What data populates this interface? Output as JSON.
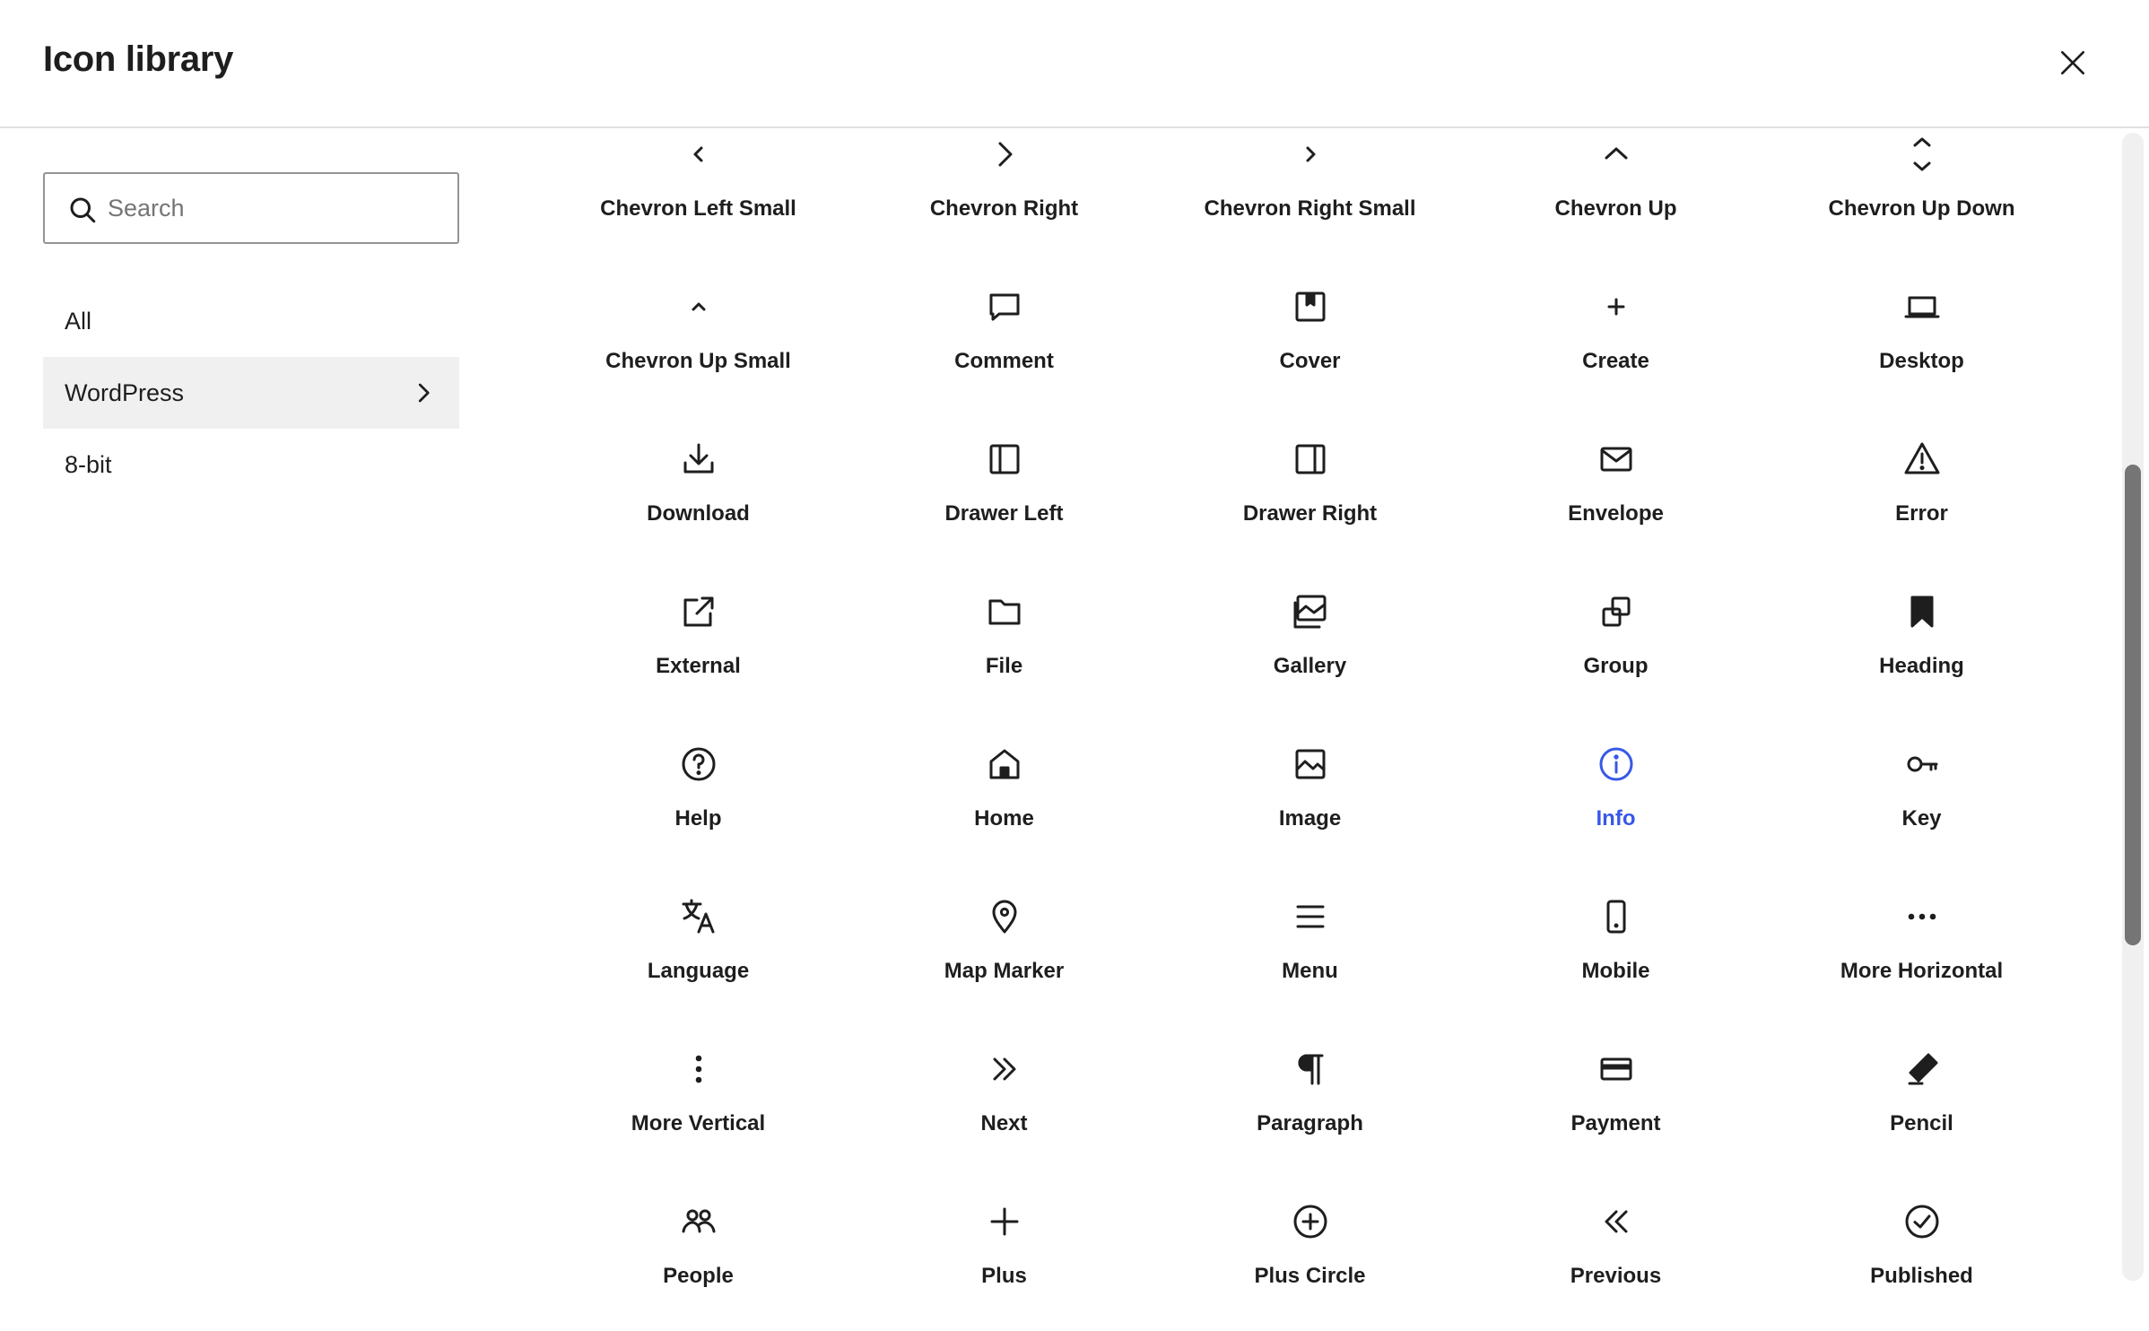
{
  "header": {
    "title": "Icon library",
    "close_icon": "close-icon"
  },
  "sidebar": {
    "search": {
      "placeholder": "Search",
      "value": ""
    },
    "items": [
      {
        "label": "All",
        "active": false
      },
      {
        "label": "WordPress",
        "active": true
      },
      {
        "label": "8-bit",
        "active": false
      }
    ]
  },
  "icons": [
    {
      "label": "Chevron Left Small",
      "icon": "chevron-left-small-icon"
    },
    {
      "label": "Chevron Right",
      "icon": "chevron-right-icon"
    },
    {
      "label": "Chevron Right Small",
      "icon": "chevron-right-small-icon"
    },
    {
      "label": "Chevron Up",
      "icon": "chevron-up-icon"
    },
    {
      "label": "Chevron Up Down",
      "icon": "chevron-up-down-icon"
    },
    {
      "label": "Chevron Up Small",
      "icon": "chevron-up-small-icon"
    },
    {
      "label": "Comment",
      "icon": "comment-icon"
    },
    {
      "label": "Cover",
      "icon": "cover-icon"
    },
    {
      "label": "Create",
      "icon": "create-icon"
    },
    {
      "label": "Desktop",
      "icon": "desktop-icon"
    },
    {
      "label": "Download",
      "icon": "download-icon"
    },
    {
      "label": "Drawer Left",
      "icon": "drawer-left-icon"
    },
    {
      "label": "Drawer Right",
      "icon": "drawer-right-icon"
    },
    {
      "label": "Envelope",
      "icon": "envelope-icon"
    },
    {
      "label": "Error",
      "icon": "error-icon"
    },
    {
      "label": "External",
      "icon": "external-icon"
    },
    {
      "label": "File",
      "icon": "file-icon"
    },
    {
      "label": "Gallery",
      "icon": "gallery-icon"
    },
    {
      "label": "Group",
      "icon": "group-icon"
    },
    {
      "label": "Heading",
      "icon": "heading-icon"
    },
    {
      "label": "Help",
      "icon": "help-icon"
    },
    {
      "label": "Home",
      "icon": "home-icon"
    },
    {
      "label": "Image",
      "icon": "image-icon"
    },
    {
      "label": "Info",
      "icon": "info-icon",
      "selected": true
    },
    {
      "label": "Key",
      "icon": "key-icon"
    },
    {
      "label": "Language",
      "icon": "language-icon"
    },
    {
      "label": "Map Marker",
      "icon": "map-marker-icon"
    },
    {
      "label": "Menu",
      "icon": "menu-icon"
    },
    {
      "label": "Mobile",
      "icon": "mobile-icon"
    },
    {
      "label": "More Horizontal",
      "icon": "more-horizontal-icon"
    },
    {
      "label": "More Vertical",
      "icon": "more-vertical-icon"
    },
    {
      "label": "Next",
      "icon": "next-icon"
    },
    {
      "label": "Paragraph",
      "icon": "paragraph-icon"
    },
    {
      "label": "Payment",
      "icon": "payment-icon"
    },
    {
      "label": "Pencil",
      "icon": "pencil-icon"
    },
    {
      "label": "People",
      "icon": "people-icon"
    },
    {
      "label": "Plus",
      "icon": "plus-icon"
    },
    {
      "label": "Plus Circle",
      "icon": "plus-circle-icon"
    },
    {
      "label": "Previous",
      "icon": "previous-icon"
    },
    {
      "label": "Published",
      "icon": "published-icon"
    }
  ],
  "colors": {
    "accent": "#3858e9",
    "text": "#1e1e1e",
    "active_bg": "#f0f0f0",
    "border": "#949494"
  }
}
